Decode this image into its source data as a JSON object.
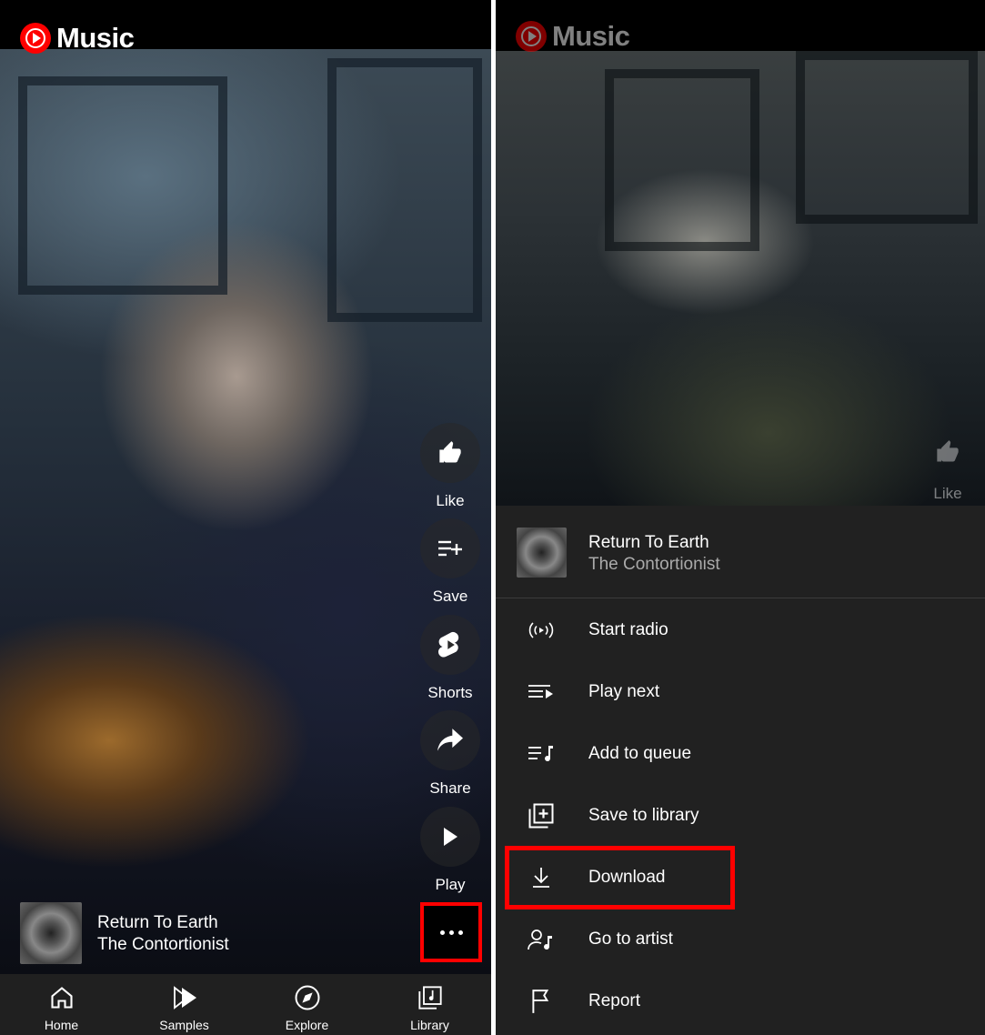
{
  "app": {
    "logo_text": "Music",
    "accent": "#ff0000"
  },
  "left": {
    "side_actions": [
      {
        "label": "Like",
        "icon": "thumbs-up-icon"
      },
      {
        "label": "Save",
        "icon": "playlist-add-icon"
      },
      {
        "label": "Shorts",
        "icon": "shorts-icon"
      },
      {
        "label": "Share",
        "icon": "share-icon"
      },
      {
        "label": "Play",
        "icon": "play-icon"
      }
    ],
    "now_playing": {
      "title": "Return To Earth",
      "artist": "The Contortionist"
    },
    "more_icon": "more-horizontal-icon",
    "nav": [
      {
        "label": "Home",
        "icon": "home-icon"
      },
      {
        "label": "Samples",
        "icon": "samples-icon"
      },
      {
        "label": "Explore",
        "icon": "compass-icon"
      },
      {
        "label": "Library",
        "icon": "library-icon"
      }
    ]
  },
  "right": {
    "like_label": "Like",
    "sheet": {
      "title": "Return To Earth",
      "artist": "The Contortionist",
      "items": [
        {
          "label": "Start radio",
          "icon": "radio-icon"
        },
        {
          "label": "Play next",
          "icon": "play-next-icon"
        },
        {
          "label": "Add to queue",
          "icon": "add-to-queue-icon"
        },
        {
          "label": "Save to library",
          "icon": "save-to-library-icon"
        },
        {
          "label": "Download",
          "icon": "download-icon"
        },
        {
          "label": "Go to artist",
          "icon": "artist-icon"
        },
        {
          "label": "Report",
          "icon": "flag-icon"
        }
      ]
    }
  }
}
